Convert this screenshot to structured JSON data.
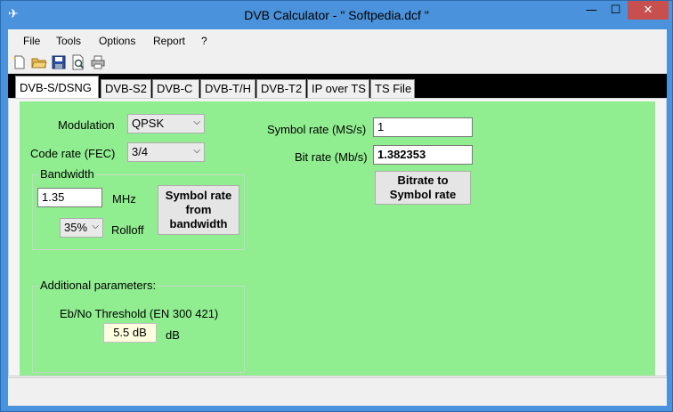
{
  "window": {
    "title": "DVB Calculator -  \" Softpedia.dcf \"",
    "controls": {
      "minimize": "—",
      "maximize": "☐",
      "close": "✕"
    },
    "app_icon": "satellite-icon",
    "colors": {
      "frame": "#4a92db",
      "close": "#c7504f"
    }
  },
  "menu": [
    "File",
    "Tools",
    "Options",
    "Report",
    "?"
  ],
  "toolbar": {
    "icons": [
      "new-file-icon",
      "open-folder-icon",
      "save-icon",
      "print-preview-icon",
      "print-icon"
    ]
  },
  "tabs": {
    "items": [
      "DVB-S/DSNG",
      "DVB-S2",
      "DVB-C",
      "DVB-T/H",
      "DVB-T2",
      "IP over TS",
      "TS File"
    ],
    "active_index": 0
  },
  "panel": {
    "background": "#90ee90",
    "modulation": {
      "label": "Modulation",
      "value": "QPSK"
    },
    "code_rate": {
      "label": "Code rate (FEC)",
      "value": "3/4"
    },
    "bandwidth": {
      "group_title": "Bandwidth",
      "value": "1.35",
      "unit": "MHz",
      "rolloff_value": "35%",
      "rolloff_label": "Rolloff",
      "button": "Symbol rate from bandwidth"
    },
    "symbol_rate": {
      "label": "Symbol rate (MS/s)",
      "value": "1"
    },
    "bit_rate": {
      "label": "Bit rate (Mb/s)",
      "value": "1.382353"
    },
    "bitrate_button": "Bitrate to Symbol rate",
    "additional": {
      "group_title": "Additional parameters:",
      "threshold_label": "Eb/No Threshold (EN 300 421)",
      "threshold_value": "5.5 dB",
      "threshold_unit": "dB"
    }
  }
}
